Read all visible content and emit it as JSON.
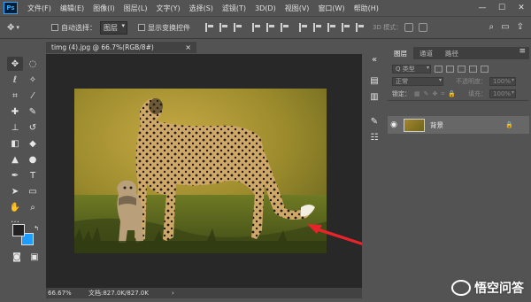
{
  "app": {
    "logo": "Ps"
  },
  "menu": [
    "文件(F)",
    "编辑(E)",
    "图像(I)",
    "图层(L)",
    "文字(Y)",
    "选择(S)",
    "滤镜(T)",
    "3D(D)",
    "视图(V)",
    "窗口(W)",
    "帮助(H)"
  ],
  "window_controls": {
    "minimize": "—",
    "maximize": "☐",
    "close": "✕"
  },
  "options": {
    "auto_select_label": "自动选择：",
    "layer_select": "图层",
    "show_transform_label": "显示变换控件",
    "mode_3d": "3D 模式："
  },
  "document": {
    "tab_title": "timg (4).jpg @ 66.7%(RGB/8#)",
    "close": "×"
  },
  "status": {
    "zoom": "66.67%",
    "doc_size": "文档:827.0K/827.0K",
    "arrow": "›"
  },
  "layers_panel": {
    "tabs": [
      "图层",
      "通道",
      "路径"
    ],
    "filter_label": "Q 类型",
    "blend_mode": "正常",
    "opacity_label": "不透明度：",
    "opacity_value": "100%",
    "lock_label": "锁定：",
    "fill_label": "填充：",
    "fill_value": "100%",
    "layers": [
      {
        "name": "背景",
        "visible": true,
        "locked": true
      }
    ]
  },
  "watermark": {
    "text": "悟空问答"
  },
  "colors": {
    "foreground": "#222222",
    "background": "#1e9dff",
    "arrow": "#e8242b"
  }
}
